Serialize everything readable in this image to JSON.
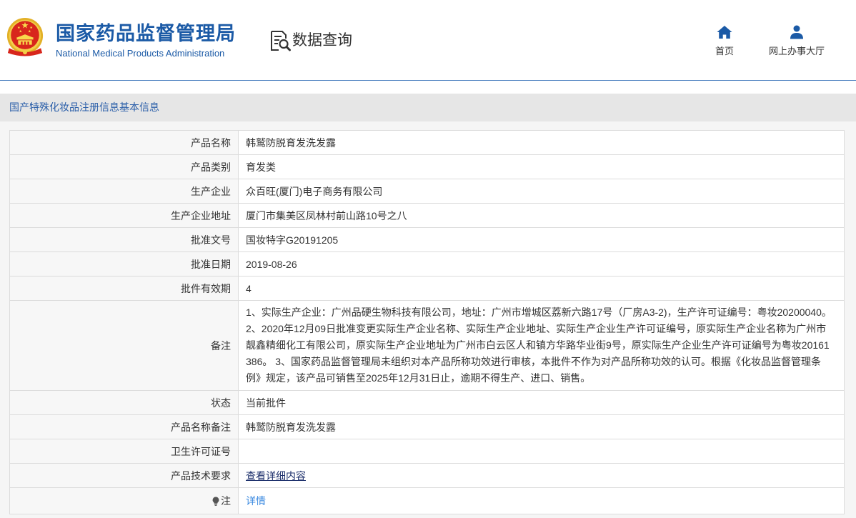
{
  "header": {
    "logo_icon": "national-emblem-icon",
    "agency_name_cn": "国家药品监督管理局",
    "agency_name_en": "National Medical Products Administration",
    "section_title": "数据查询",
    "section_icon": "search-document-icon",
    "nav": [
      {
        "label": "首页",
        "icon": "home-icon"
      },
      {
        "label": "网上办事大厅",
        "icon": "user-icon"
      }
    ]
  },
  "panel": {
    "title": "国产特殊化妆品注册信息基本信息"
  },
  "rows": [
    {
      "label": "产品名称",
      "value": "韩鹫防脱育发洗发露"
    },
    {
      "label": "产品类别",
      "value": "育发类"
    },
    {
      "label": "生产企业",
      "value": "众百旺(厦门)电子商务有限公司"
    },
    {
      "label": "生产企业地址",
      "value": "厦门市集美区凤林村前山路10号之八"
    },
    {
      "label": "批准文号",
      "value": "国妆特字G20191205"
    },
    {
      "label": "批准日期",
      "value": "2019-08-26"
    },
    {
      "label": "批件有效期",
      "value": "4"
    },
    {
      "label": "备注",
      "value": "1、实际生产企业：广州品硬生物科技有限公司，地址：广州市增城区荔新六路17号（厂房A3-2)，生产许可证编号：粤妆20200040。 2、2020年12月09日批准变更实际生产企业名称、实际生产企业地址、实际生产企业生产许可证编号，原实际生产企业名称为广州市靓鑫精细化工有限公司，原实际生产企业地址为广州市白云区人和镇方华路华业街9号，原实际生产企业生产许可证编号为粤妆20161386。 3、国家药品监督管理局未组织对本产品所称功效进行审核，本批件不作为对产品所称功效的认可。根据《化妆品监督管理条例》规定，该产品可销售至2025年12月31日止，逾期不得生产、进口、销售。"
    },
    {
      "label": "状态",
      "value": "当前批件"
    },
    {
      "label": "产品名称备注",
      "value": "韩鹫防脱育发洗发露"
    },
    {
      "label": "卫生许可证号",
      "value": ""
    },
    {
      "label": "产品技术要求",
      "value": "查看详细内容"
    },
    {
      "label": "注",
      "value": "详情",
      "icon": "lightbulb-icon"
    }
  ],
  "colors": {
    "brand_blue": "#1b5aa6",
    "panel_title": "#2b5fa9",
    "link_dark": "#1c2f6b",
    "link_blue": "#3b8ae0"
  }
}
